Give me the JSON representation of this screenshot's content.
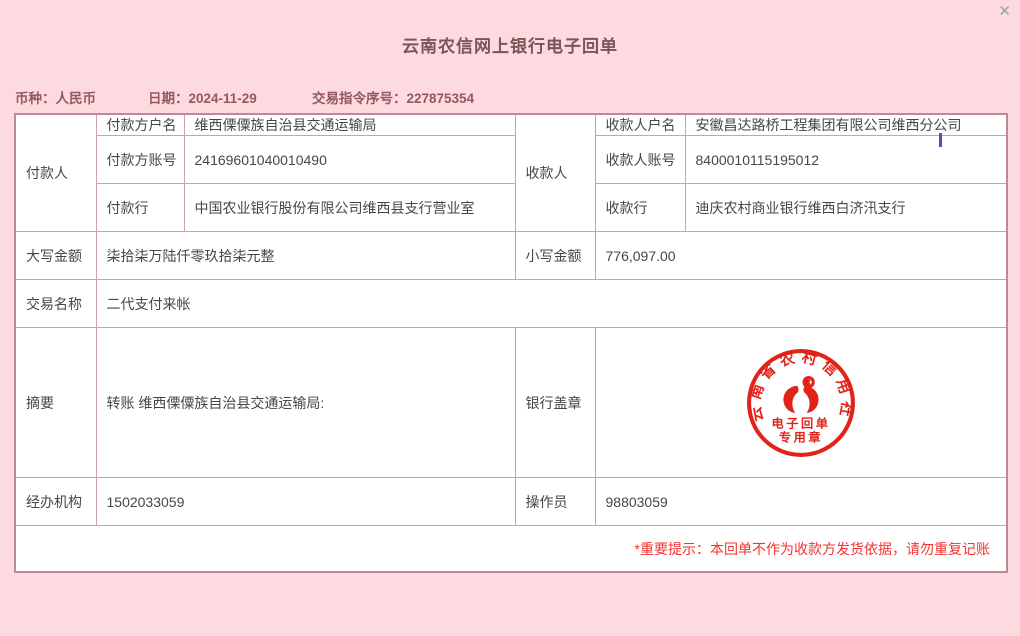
{
  "window": {
    "close_icon": "✕"
  },
  "title": "云南农信网上银行电子回单",
  "meta": {
    "currency": {
      "label": "币种：",
      "value": "人民币"
    },
    "date": {
      "label": "日期：",
      "value": "2024-11-29"
    },
    "serial": {
      "label": "交易指令序号：",
      "value": "227875354"
    }
  },
  "table": {
    "payer": {
      "group": "付款人",
      "name_label": "付款方户名",
      "name": "维西傈僳族自治县交通运输局",
      "account_label": "付款方账号",
      "account": "24169601040010490",
      "bank_label": "付款行",
      "bank": "中国农业银行股份有限公司维西县支行营业室"
    },
    "payee": {
      "group": "收款人",
      "name_label": "收款人户名",
      "name": "安徽昌达路桥工程集团有限公司维西分公司",
      "account_label": "收款人账号",
      "account": "8400010115195012",
      "bank_label": "收款行",
      "bank": "迪庆农村商业银行维西白济汛支行"
    },
    "amount": {
      "words_label": "大写金额",
      "words": "柒拾柒万陆仟零玖拾柒元整",
      "figures_label": "小写金额",
      "figures": "776,097.00"
    },
    "transaction": {
      "label": "交易名称",
      "value": "二代支付来帐"
    },
    "summary": {
      "label": "摘要",
      "value": "转账 维西傈僳族自治县交通运输局:"
    },
    "seal": {
      "label": "银行盖章",
      "arc_text": "云南省农村信用社",
      "line1": "电子回单",
      "line2": "专用章",
      "color": "#e2231a"
    },
    "agency": {
      "label": "经办机构",
      "value": "1502033059"
    },
    "operator": {
      "label": "操作员",
      "value": "98803059"
    }
  },
  "footer": {
    "notice": "*重要提示：本回单不作为收款方发货依据，请勿重复记账"
  },
  "colors": {
    "background": "#fcdadf",
    "panel": "#ffffff",
    "border_outer": "#bd8a94",
    "border_inner": "#cfa0aa",
    "title_text": "#7d5357",
    "meta_text": "#95585e",
    "body_text": "#464646",
    "notice_text": "#f53232",
    "seal_red": "#e2231a",
    "caret": "#4b52c8"
  }
}
